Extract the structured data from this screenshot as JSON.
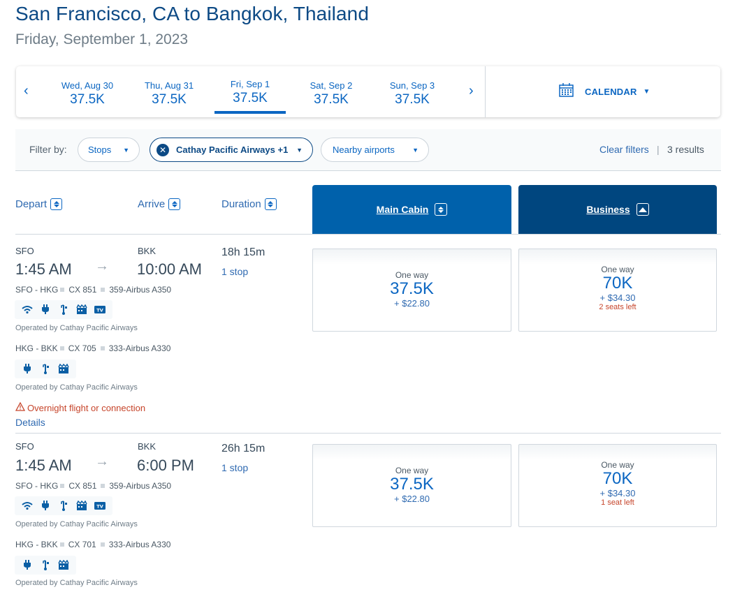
{
  "header": {
    "title": "San Francisco, CA to Bangkok, Thailand",
    "date": "Friday, September 1, 2023"
  },
  "date_strip": {
    "prev_icon": "‹",
    "next_icon": "›",
    "dates": [
      {
        "label": "Wed, Aug 30",
        "price": "37.5K"
      },
      {
        "label": "Thu, Aug 31",
        "price": "37.5K"
      },
      {
        "label": "Fri, Sep 1",
        "price": "37.5K",
        "selected": true
      },
      {
        "label": "Sat, Sep 2",
        "price": "37.5K"
      },
      {
        "label": "Sun, Sep 3",
        "price": "37.5K"
      }
    ],
    "calendar_label": "CALENDAR"
  },
  "filters": {
    "label": "Filter by:",
    "stops": "Stops",
    "airline": "Cathay Pacific Airways +1",
    "nearby": "Nearby airports",
    "clear": "Clear filters",
    "separator": "|",
    "results": "3 results"
  },
  "columns": {
    "depart": "Depart",
    "arrive": "Arrive",
    "duration": "Duration",
    "main_cabin": "Main Cabin",
    "business": "Business"
  },
  "colors": {
    "accent": "#0b66c2",
    "main_cabin_bg": "#0061ab",
    "business_bg": "#00467f",
    "warning": "#c6442a"
  },
  "flights": [
    {
      "origin": "SFO",
      "destination": "BKK",
      "depart_time": "1:45 AM",
      "arrive_time": "10:00 AM",
      "duration": "18h 15m",
      "stops": "1 stop",
      "segments": [
        {
          "route": "SFO - HKG",
          "flight": "CX 851",
          "aircraft": "359-Airbus A350",
          "amenities": [
            "wifi",
            "power",
            "usb",
            "entertainment",
            "tv"
          ],
          "operated_by": "Operated by Cathay Pacific Airways"
        },
        {
          "route": "HKG - BKK",
          "flight": "CX 705",
          "aircraft": "333-Airbus A330",
          "amenities": [
            "power",
            "usb",
            "entertainment"
          ],
          "operated_by": "Operated by Cathay Pacific Airways"
        }
      ],
      "warning": "Overnight flight or connection",
      "details": "Details",
      "main_cabin": {
        "label": "One way",
        "miles": "37.5K",
        "taxes": "+ $22.80"
      },
      "business": {
        "label": "One way",
        "miles": "70K",
        "taxes": "+ $34.30",
        "seats_left": "2 seats left"
      }
    },
    {
      "origin": "SFO",
      "destination": "BKK",
      "depart_time": "1:45 AM",
      "arrive_time": "6:00 PM",
      "duration": "26h 15m",
      "stops": "1 stop",
      "segments": [
        {
          "route": "SFO - HKG",
          "flight": "CX 851",
          "aircraft": "359-Airbus A350",
          "amenities": [
            "wifi",
            "power",
            "usb",
            "entertainment",
            "tv"
          ],
          "operated_by": "Operated by Cathay Pacific Airways"
        },
        {
          "route": "HKG - BKK",
          "flight": "CX 701",
          "aircraft": "333-Airbus A330",
          "amenities": [
            "power",
            "usb",
            "entertainment"
          ],
          "operated_by": "Operated by Cathay Pacific Airways"
        }
      ],
      "main_cabin": {
        "label": "One way",
        "miles": "37.5K",
        "taxes": "+ $22.80"
      },
      "business": {
        "label": "One way",
        "miles": "70K",
        "taxes": "+ $34.30",
        "seats_left": "1 seat left"
      }
    }
  ]
}
